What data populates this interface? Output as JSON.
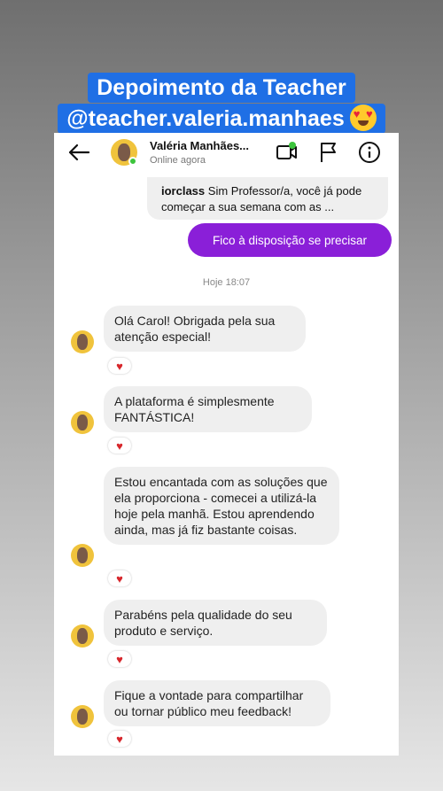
{
  "story_title": {
    "line1": "Depoimento da Teacher",
    "line2": "@teacher.valeria.manhaes"
  },
  "header": {
    "contact_name": "Valéria Manhães...",
    "status": "Online agora"
  },
  "quoted_message": {
    "sender": "iorclass",
    "text": "Sim Professor/a, você já pode começar a sua semana com as ..."
  },
  "outgoing_message": "Fico à disposição se precisar",
  "timestamp": "Hoje 18:07",
  "messages": [
    {
      "text": "Olá Carol! Obrigada pela sua atenção especial!",
      "reaction": "♥"
    },
    {
      "text": "A plataforma é simplesmente FANTÁSTICA!",
      "reaction": "♥"
    },
    {
      "text": "Estou encantada com as soluções que ela proporciona - comecei a utilizá-la hoje pela manhã. Estou aprendendo ainda, mas já fiz bastante coisas.",
      "reaction": "♥"
    },
    {
      "text": "Parabéns pela qualidade do seu produto e serviço.",
      "reaction": "♥"
    },
    {
      "text": "Fique a vontade para compartilhar ou tornar público meu feedback!",
      "reaction": "♥"
    }
  ],
  "colors": {
    "title_bg": "#1f6fe5",
    "outgoing_bubble": "#8a1fd8",
    "incoming_bubble": "#efefef",
    "online": "#3cc43c",
    "heart": "#d7262b"
  }
}
